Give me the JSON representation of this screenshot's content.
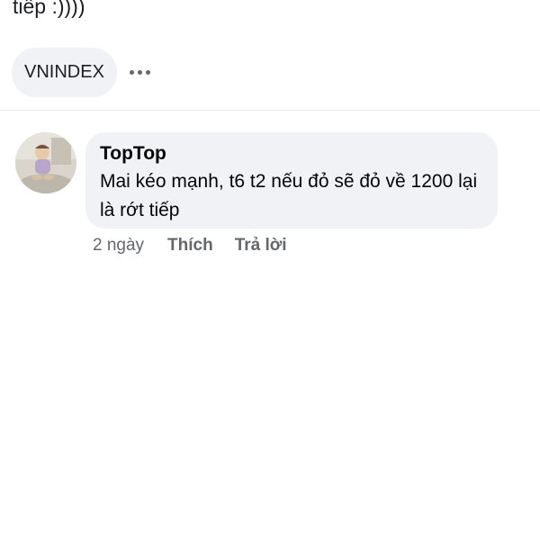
{
  "post": {
    "text_tail": "tiếp :))))",
    "tag": "VNINDEX",
    "more_icon": "more-horizontal-icon"
  },
  "comment": {
    "author": "TopTop",
    "text": "Mai kéo mạnh, t6 t2 nếu đỏ sẽ đỏ về 1200 lại là rớt tiếp",
    "time": "2 ngày",
    "like_label": "Thích",
    "reply_label": "Trả lời"
  },
  "colors": {
    "bubble": "#f0f2f5",
    "meta_text": "#65676b",
    "divider": "#e4e6eb"
  }
}
